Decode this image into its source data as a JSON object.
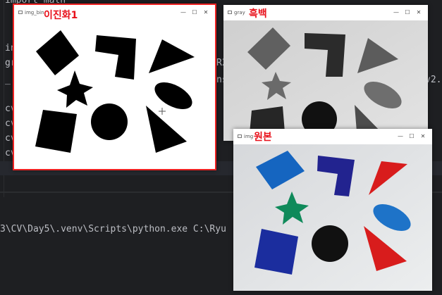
{
  "editor": {
    "lines": [
      "import math",
      "in",
      "gr",
      "_",
      "cv",
      "cv",
      "cv",
      "cv"
    ],
    "partials": [
      "R2",
      "ns",
      "v2."
    ]
  },
  "console": {
    "command": "3\\CV\\Day5\\.venv\\Scripts\\python.exe C:\\Ryu"
  },
  "windows": {
    "binary": {
      "title": "img_bin",
      "label": "이진화1"
    },
    "gray": {
      "title": "gray",
      "label": "흑백"
    },
    "original": {
      "title": "img",
      "label": "원본"
    }
  },
  "controls": {
    "minimize": "—",
    "maximize": "☐",
    "close": "✕"
  },
  "colors": {
    "blue_rect": "#1565c0",
    "navy_L": "#22238f",
    "red_triangle": "#d81c1c",
    "green_star": "#0f8a5a",
    "blue_ellipse": "#1e73c8",
    "dark_blue_square": "#1b2d9e",
    "black_circle": "#111111",
    "label_red": "#e8101a"
  }
}
